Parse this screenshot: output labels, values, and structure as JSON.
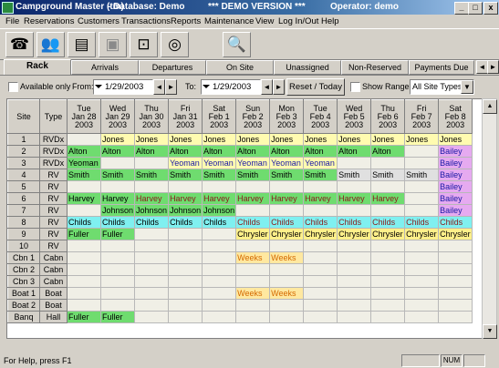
{
  "window": {
    "app_title": "Campground Master (tm)",
    "database": "- Database: Demo",
    "demo": "*** DEMO VERSION ***",
    "operator": "Operator: demo",
    "min": "_",
    "max": "□",
    "close": "x"
  },
  "menu": [
    "File",
    "Reservations",
    "Customers",
    "Transactions",
    "Reports",
    "Maintenance",
    "View",
    "Log In/Out",
    "Help"
  ],
  "toolbar": [
    {
      "icon": "phone-icon",
      "glyph": "☎",
      "enabled": true
    },
    {
      "icon": "customers-icon",
      "glyph": "👥",
      "enabled": true
    },
    {
      "icon": "cards-icon",
      "glyph": "▤",
      "enabled": true
    },
    {
      "icon": "save-icon",
      "glyph": "▣",
      "enabled": false
    },
    {
      "icon": "safe-icon",
      "glyph": "⊡",
      "enabled": true
    },
    {
      "icon": "backup-icon",
      "glyph": "◎",
      "enabled": true
    },
    {
      "icon": "magnifier-icon",
      "glyph": "🔍",
      "enabled": true
    }
  ],
  "tabs": [
    "Rack",
    "Arrivals",
    "Departures",
    "On Site",
    "Unassigned",
    "Non-Reserved",
    "Payments Due"
  ],
  "filter": {
    "available_only": "Available only",
    "from_label": "From:",
    "from_date": "1/29/2003",
    "to_label": "To:",
    "to_date": "1/29/2003",
    "reset_button": "Reset / Today",
    "show_range": "Show Range",
    "site_types": "All Site Types",
    "prev": "◄",
    "next": "►",
    "dropdown": "▼"
  },
  "grid": {
    "header_site": "Site",
    "header_type": "Type",
    "days": [
      {
        "dow": "Tue",
        "date": "Jan 28",
        "year": "2003"
      },
      {
        "dow": "Wed",
        "date": "Jan 29",
        "year": "2003"
      },
      {
        "dow": "Thu",
        "date": "Jan 30",
        "year": "2003"
      },
      {
        "dow": "Fri",
        "date": "Jan 31",
        "year": "2003"
      },
      {
        "dow": "Sat",
        "date": "Feb 1",
        "year": "2003"
      },
      {
        "dow": "Sun",
        "date": "Feb 2",
        "year": "2003"
      },
      {
        "dow": "Mon",
        "date": "Feb 3",
        "year": "2003"
      },
      {
        "dow": "Tue",
        "date": "Feb 4",
        "year": "2003"
      },
      {
        "dow": "Wed",
        "date": "Feb 5",
        "year": "2003"
      },
      {
        "dow": "Thu",
        "date": "Feb 6",
        "year": "2003"
      },
      {
        "dow": "Fri",
        "date": "Feb 7",
        "year": "2003"
      },
      {
        "dow": "Sat",
        "date": "Feb 8",
        "year": "2003"
      }
    ],
    "rows": [
      {
        "site": "1",
        "type": "RVDx",
        "cells": [
          "",
          "Jones",
          "Jones",
          "Jones",
          "Jones",
          "Jones",
          "Jones",
          "Jones",
          "Jones",
          "Jones",
          "Jones",
          "Jones"
        ],
        "colors": [
          "",
          "#fffbb0",
          "#fffbb0",
          "#fffbb0",
          "#fffbb0",
          "#fffbb0",
          "#fffbb0",
          "#fffbb0",
          "#fffbb0",
          "#fffbb0",
          "#fffbb0",
          "#fffbb0"
        ],
        "fg": [
          "",
          "#000",
          "#000",
          "#000",
          "#000",
          "#000",
          "#000",
          "#000",
          "#000",
          "#000",
          "#000",
          "#000"
        ]
      },
      {
        "site": "2",
        "type": "RVDx",
        "cells": [
          "Alton",
          "Alton",
          "Alton",
          "Alton",
          "Alton",
          "Alton",
          "Alton",
          "Alton",
          "Alton",
          "Alton",
          "",
          "Bailey"
        ],
        "colors": [
          "#6fdc6f",
          "#6fdc6f",
          "#6fdc6f",
          "#6fdc6f",
          "#6fdc6f",
          "#6fdc6f",
          "#6fdc6f",
          "#6fdc6f",
          "#6fdc6f",
          "#6fdc6f",
          "",
          "#e6aaf0"
        ],
        "fg": [
          "#000",
          "#000",
          "#000",
          "#000",
          "#000",
          "#000",
          "#000",
          "#000",
          "#000",
          "#000",
          "",
          "#1a1aa6"
        ]
      },
      {
        "site": "3",
        "type": "RVDx",
        "cells": [
          "Yeoman",
          "",
          "",
          "Yeoman",
          "Yeoman",
          "Yeoman",
          "Yeoman",
          "Yeoman",
          "",
          "",
          "",
          "Bailey"
        ],
        "colors": [
          "#6fdc6f",
          "",
          "",
          "#fffbb0",
          "#fffbb0",
          "#fffbb0",
          "#fffbb0",
          "#fffbb0",
          "",
          "",
          "",
          "#e6aaf0"
        ],
        "fg": [
          "#000",
          "",
          "",
          "#1a1aa6",
          "#1a1aa6",
          "#1a1aa6",
          "#1a1aa6",
          "#1a1aa6",
          "",
          "",
          "",
          "#1a1aa6"
        ]
      },
      {
        "site": "4",
        "type": "RV",
        "cells": [
          "Smith",
          "Smith",
          "Smith",
          "Smith",
          "Smith",
          "Smith",
          "Smith",
          "Smith",
          "Smith",
          "Smith",
          "Smith",
          "Bailey"
        ],
        "colors": [
          "#6fdc6f",
          "#6fdc6f",
          "#6fdc6f",
          "#6fdc6f",
          "#6fdc6f",
          "#6fdc6f",
          "#6fdc6f",
          "#6fdc6f",
          "#e0e0e0",
          "#e0e0e0",
          "#e0e0e0",
          "#e6aaf0"
        ],
        "fg": [
          "#000",
          "#000",
          "#000",
          "#000",
          "#000",
          "#000",
          "#000",
          "#000",
          "#000",
          "#000",
          "#000",
          "#1a1aa6"
        ]
      },
      {
        "site": "5",
        "type": "RV",
        "cells": [
          "",
          "",
          "",
          "",
          "",
          "",
          "",
          "",
          "",
          "",
          "",
          "Bailey"
        ],
        "colors": [
          "",
          "",
          "",
          "",
          "",
          "",
          "",
          "",
          "",
          "",
          "",
          "#e6aaf0"
        ],
        "fg": [
          "",
          "",
          "",
          "",
          "",
          "",
          "",
          "",
          "",
          "",
          "",
          "#1a1aa6"
        ]
      },
      {
        "site": "6",
        "type": "RV",
        "cells": [
          "Harvey",
          "Harvey",
          "Harvey",
          "Harvey",
          "Harvey",
          "Harvey",
          "Harvey",
          "Harvey",
          "Harvey",
          "Harvey",
          "",
          "Bailey"
        ],
        "colors": [
          "#6fdc6f",
          "#6fdc6f",
          "#6fdc6f",
          "#6fdc6f",
          "#6fdc6f",
          "#6fdc6f",
          "#6fdc6f",
          "#6fdc6f",
          "#6fdc6f",
          "#6fdc6f",
          "",
          "#e6aaf0"
        ],
        "fg": [
          "#000",
          "#000",
          "#8b1a1a",
          "#8b1a1a",
          "#8b1a1a",
          "#8b1a1a",
          "#8b1a1a",
          "#8b1a1a",
          "#8b1a1a",
          "#8b1a1a",
          "",
          "#1a1aa6"
        ]
      },
      {
        "site": "7",
        "type": "RV",
        "cells": [
          "",
          "Johnson",
          "Johnson",
          "Johnson",
          "Johnson",
          "",
          "",
          "",
          "",
          "",
          "",
          "Bailey"
        ],
        "colors": [
          "",
          "#6fdc6f",
          "#6fdc6f",
          "#6fdc6f",
          "#6fdc6f",
          "",
          "",
          "",
          "",
          "",
          "",
          "#e6aaf0"
        ],
        "fg": [
          "",
          "#000",
          "#000",
          "#000",
          "#000",
          "",
          "",
          "",
          "",
          "",
          "",
          "#1a1aa6"
        ]
      },
      {
        "site": "8",
        "type": "RV",
        "cells": [
          "Childs",
          "Childs",
          "Childs",
          "Childs",
          "Childs",
          "Childs",
          "Childs",
          "Childs",
          "Childs",
          "Childs",
          "Childs",
          "Childs"
        ],
        "colors": [
          "#7ff0f0",
          "#7ff0f0",
          "#7ff0f0",
          "#7ff0f0",
          "#7ff0f0",
          "#7ff0f0",
          "#7ff0f0",
          "#7ff0f0",
          "#7ff0f0",
          "#7ff0f0",
          "#7ff0f0",
          "#7ff0f0"
        ],
        "fg": [
          "#000",
          "#000",
          "#000",
          "#000",
          "#000",
          "#8b1a1a",
          "#8b1a1a",
          "#8b1a1a",
          "#8b1a1a",
          "#8b1a1a",
          "#8b1a1a",
          "#8b1a1a"
        ]
      },
      {
        "site": "9",
        "type": "RV",
        "cells": [
          "Fuller",
          "Fuller",
          "",
          "",
          "",
          "Chrysler",
          "Chrysler",
          "Chrysler",
          "Chrysler",
          "Chrysler",
          "Chrysler",
          "Chrysler"
        ],
        "colors": [
          "#6fdc6f",
          "#6fdc6f",
          "",
          "",
          "",
          "#fff08a",
          "#fff08a",
          "#fff08a",
          "#fff08a",
          "#fff08a",
          "#fff08a",
          "#fff08a"
        ],
        "fg": [
          "#000",
          "#000",
          "",
          "",
          "",
          "#000",
          "#000",
          "#000",
          "#000",
          "#000",
          "#000",
          "#000"
        ]
      },
      {
        "site": "10",
        "type": "RV",
        "cells": [
          "",
          "",
          "",
          "",
          "",
          "",
          "",
          "",
          "",
          "",
          "",
          ""
        ],
        "colors": [
          "",
          "",
          "",
          "",
          "",
          "",
          "",
          "",
          "",
          "",
          "",
          ""
        ],
        "fg": [
          "",
          "",
          "",
          "",
          "",
          "",
          "",
          "",
          "",
          "",
          "",
          ""
        ]
      },
      {
        "site": "Cbn 1",
        "type": "Cabn",
        "cells": [
          "",
          "",
          "",
          "",
          "",
          "Weeks",
          "Weeks",
          "",
          "",
          "",
          "",
          ""
        ],
        "colors": [
          "",
          "",
          "",
          "",
          "",
          "#ffe8a0",
          "#ffe8a0",
          "",
          "",
          "",
          "",
          ""
        ],
        "fg": [
          "",
          "",
          "",
          "",
          "",
          "#d46a00",
          "#d46a00",
          "",
          "",
          "",
          "",
          ""
        ]
      },
      {
        "site": "Cbn 2",
        "type": "Cabn",
        "cells": [
          "",
          "",
          "",
          "",
          "",
          "",
          "",
          "",
          "",
          "",
          "",
          ""
        ],
        "colors": [
          "",
          "",
          "",
          "",
          "",
          "",
          "",
          "",
          "",
          "",
          "",
          ""
        ],
        "fg": [
          "",
          "",
          "",
          "",
          "",
          "",
          "",
          "",
          "",
          "",
          "",
          ""
        ]
      },
      {
        "site": "Cbn 3",
        "type": "Cabn",
        "cells": [
          "",
          "",
          "",
          "",
          "",
          "",
          "",
          "",
          "",
          "",
          "",
          ""
        ],
        "colors": [
          "",
          "",
          "",
          "",
          "",
          "",
          "",
          "",
          "",
          "",
          "",
          ""
        ],
        "fg": [
          "",
          "",
          "",
          "",
          "",
          "",
          "",
          "",
          "",
          "",
          "",
          ""
        ]
      },
      {
        "site": "Boat 1",
        "type": "Boat",
        "cells": [
          "",
          "",
          "",
          "",
          "",
          "Weeks",
          "Weeks",
          "",
          "",
          "",
          "",
          ""
        ],
        "colors": [
          "",
          "",
          "",
          "",
          "",
          "#ffe8a0",
          "#ffe8a0",
          "",
          "",
          "",
          "",
          ""
        ],
        "fg": [
          "",
          "",
          "",
          "",
          "",
          "#d46a00",
          "#d46a00",
          "",
          "",
          "",
          "",
          ""
        ]
      },
      {
        "site": "Boat 2",
        "type": "Boat",
        "cells": [
          "",
          "",
          "",
          "",
          "",
          "",
          "",
          "",
          "",
          "",
          "",
          ""
        ],
        "colors": [
          "",
          "",
          "",
          "",
          "",
          "",
          "",
          "",
          "",
          "",
          "",
          ""
        ],
        "fg": [
          "",
          "",
          "",
          "",
          "",
          "",
          "",
          "",
          "",
          "",
          "",
          ""
        ]
      },
      {
        "site": "Banq",
        "type": "Hall",
        "cells": [
          "Fuller",
          "Fuller",
          "",
          "",
          "",
          "",
          "",
          "",
          "",
          "",
          "",
          ""
        ],
        "colors": [
          "#6fdc6f",
          "#6fdc6f",
          "",
          "",
          "",
          "",
          "",
          "",
          "",
          "",
          "",
          ""
        ],
        "fg": [
          "#000",
          "#000",
          "",
          "",
          "",
          "",
          "",
          "",
          "",
          "",
          "",
          ""
        ]
      }
    ]
  },
  "status": {
    "message": "For Help, press F1",
    "num": "NUM"
  }
}
